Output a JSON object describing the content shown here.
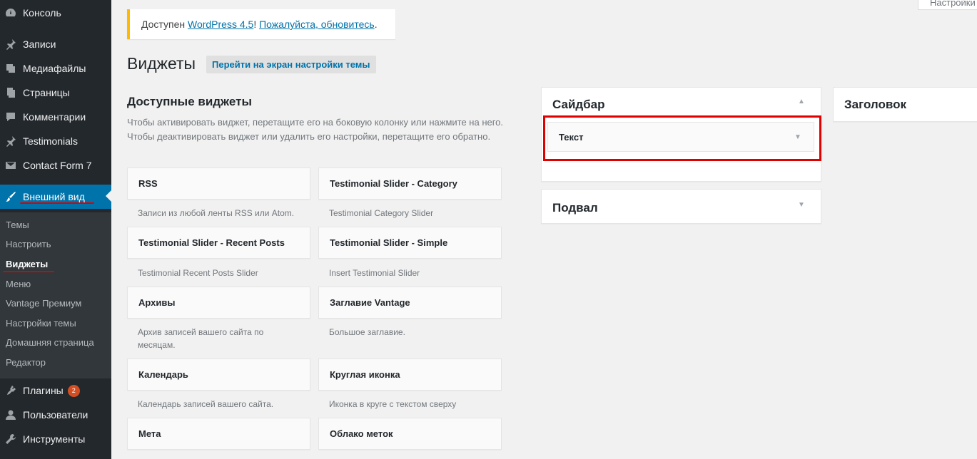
{
  "menu": [
    {
      "label": "Консоль",
      "icon": "dashboard-icon"
    },
    {
      "label": "Записи",
      "icon": "pin-icon"
    },
    {
      "label": "Медиафайлы",
      "icon": "media-icon"
    },
    {
      "label": "Страницы",
      "icon": "pages-icon"
    },
    {
      "label": "Комментарии",
      "icon": "comment-icon"
    },
    {
      "label": "Testimonials",
      "icon": "pin-icon"
    },
    {
      "label": "Contact Form 7",
      "icon": "mail-icon"
    },
    {
      "label": "Внешний вид",
      "icon": "brush-icon"
    },
    {
      "label": "Плагины",
      "icon": "plugin-icon",
      "badge": "2"
    },
    {
      "label": "Пользователи",
      "icon": "user-icon"
    },
    {
      "label": "Инструменты",
      "icon": "wrench-icon"
    }
  ],
  "submenu": [
    "Темы",
    "Настроить",
    "Виджеты",
    "Меню",
    "Vantage Премиум",
    "Настройки темы",
    "Домашняя страница",
    "Редактор"
  ],
  "screen_options": "Настройки",
  "notice": {
    "prefix": "Доступен ",
    "link1": "WordPress 4.5",
    "middle": "! ",
    "link2": "Пожалуйста, обновитесь",
    "suffix": "."
  },
  "page_title": "Виджеты",
  "title_action": "Перейти на экран настройки темы",
  "available": {
    "title": "Доступные виджеты",
    "description": "Чтобы активировать виджет, перетащите его на боковую колонку или нажмите на него. Чтобы деактивировать виджет или удалить его настройки, перетащите его обратно."
  },
  "widgets": [
    {
      "title": "RSS",
      "desc": "Записи из любой ленты RSS или Atom."
    },
    {
      "title": "Testimonial Slider - Category",
      "desc": "Testimonial Category Slider"
    },
    {
      "title": "Testimonial Slider - Recent Posts",
      "desc": "Testimonial Recent Posts Slider"
    },
    {
      "title": "Testimonial Slider - Simple",
      "desc": "Insert Testimonial Slider"
    },
    {
      "title": "Архивы",
      "desc": "Архив записей вашего сайта по месяцам."
    },
    {
      "title": "Заглавие Vantage",
      "desc": "Большое заглавие."
    },
    {
      "title": "Календарь",
      "desc": "Календарь записей вашего сайта."
    },
    {
      "title": "Круглая иконка",
      "desc": "Иконка в круге с текстом сверху"
    },
    {
      "title": "Мета",
      "desc": ""
    },
    {
      "title": "Облако меток",
      "desc": ""
    }
  ],
  "sidebars": {
    "sidebar": {
      "title": "Сайдбар",
      "widget": "Текст"
    },
    "footer": {
      "title": "Подвал"
    },
    "header": {
      "title": "Заголовок"
    }
  },
  "colors": {
    "menu_bg": "#23282d",
    "submenu_bg": "#32373c",
    "accent": "#0073aa",
    "annotation": "#e00000",
    "notice_border": "#ffb900"
  }
}
